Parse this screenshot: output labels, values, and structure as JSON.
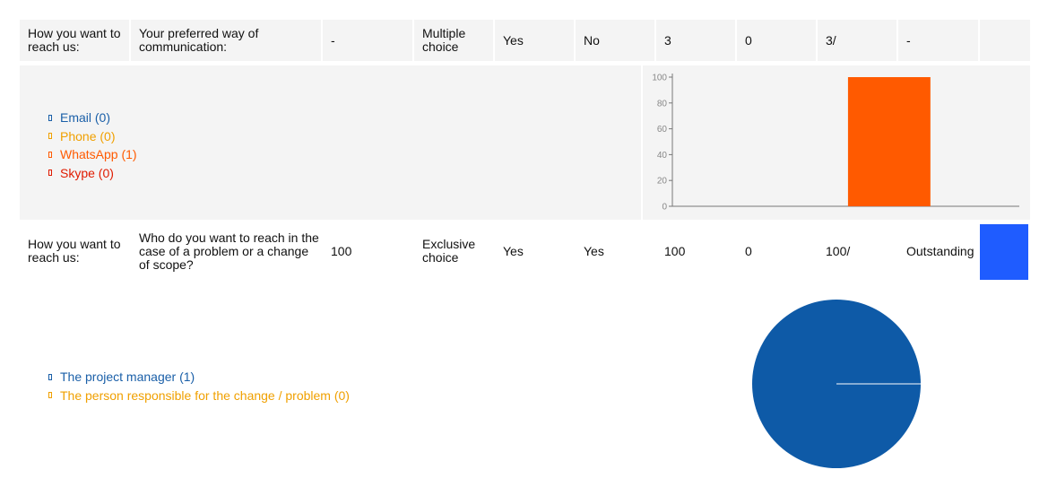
{
  "rows": [
    {
      "category": "How you want to reach us:",
      "question": "Your preferred way of communication:",
      "col3": "-",
      "type": "Multiple choice",
      "col5": "Yes",
      "col6": "No",
      "col7": "3",
      "col8": "0",
      "col9": "3/",
      "col10": "-",
      "col11": ""
    },
    {
      "category": "How you want to reach us:",
      "question": "Who do you want to reach in the case of a problem or a change of scope?",
      "col3": "100",
      "type": "Exclusive choice",
      "col5": "Yes",
      "col6": "Yes",
      "col7": "100",
      "col8": "0",
      "col9": "100/",
      "col10": "Outstanding",
      "col11_color": "#1f5cff"
    }
  ],
  "legend1": [
    {
      "label": "Email (0)",
      "color": "#1a5fa8"
    },
    {
      "label": "Phone (0)",
      "color": "#f0a000"
    },
    {
      "label": "WhatsApp (1)",
      "color": "#ff5a00"
    },
    {
      "label": "Skype (0)",
      "color": "#e01b00"
    }
  ],
  "legend2": [
    {
      "label": "The project manager (1)",
      "color": "#1a5fa8"
    },
    {
      "label": "The person responsible for the change / problem (0)",
      "color": "#f0a000"
    }
  ],
  "chart_data": [
    {
      "type": "bar",
      "categories": [
        "Email",
        "Phone",
        "WhatsApp",
        "Skype"
      ],
      "values": [
        0,
        0,
        100,
        0
      ],
      "colors": [
        "#1a5fa8",
        "#f0a000",
        "#ff5a00",
        "#e01b00"
      ],
      "ylim": [
        0,
        100
      ],
      "yticks": [
        "0",
        "20",
        "40",
        "60",
        "80",
        "100"
      ],
      "grid": false
    },
    {
      "type": "pie",
      "categories": [
        "The project manager",
        "The person responsible for the change / problem"
      ],
      "values": [
        1,
        0
      ],
      "colors": [
        "#0e5aa7",
        "#f0a000"
      ]
    }
  ]
}
